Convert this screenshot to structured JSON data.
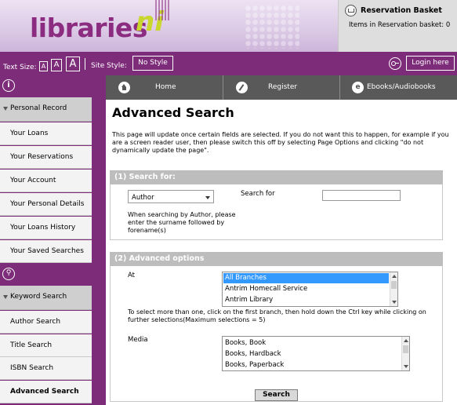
{
  "header": {
    "logo_text": "libraries",
    "logo_ni": "ni",
    "basket_title": "Reservation Basket",
    "basket_items": "Items in Reservation basket: 0"
  },
  "toolbar": {
    "text_size_label": "Text Size:",
    "text_size_options": [
      "A",
      "A",
      "A"
    ],
    "site_style_label": "Site Style:",
    "site_style_value": "No Style",
    "login_label": "Login here"
  },
  "sidebar": {
    "section1": {
      "icon": "info-icon",
      "header": "Personal Record",
      "items": [
        "Your Loans",
        "Your Reservations",
        "Your Account",
        "Your Personal Details",
        "Your Loans History",
        "Your Saved Searches"
      ]
    },
    "section2": {
      "icon": "search-icon",
      "header": "Keyword Search",
      "items": [
        "Author Search",
        "Title Search",
        "ISBN Search",
        "Advanced Search"
      ],
      "active": "Advanced Search"
    }
  },
  "nav": {
    "tabs": [
      {
        "label": "Home",
        "icon": "home-icon"
      },
      {
        "label": "Register",
        "icon": "pencil-icon"
      },
      {
        "label": "Ebooks/Audiobooks",
        "icon": "ebook-icon"
      }
    ]
  },
  "main": {
    "title": "Advanced Search",
    "intro": "This page will update once certain fields are selected. If you do not want this to happen, for example if you are a screen reader user, then please switch this off by selecting Page Options and clicking \"do not dynamically update the page\".",
    "search_for": {
      "heading": "(1) Search for:",
      "field_selected": "Author",
      "search_for_label": "Search for",
      "search_value": "",
      "help": "When searching by Author, please enter the surname followed by forename(s)"
    },
    "advanced": {
      "heading": "(2) Advanced options",
      "at_label": "At",
      "branches": [
        "All Branches",
        "Antrim Homecall Service",
        "Antrim Library"
      ],
      "branch_selected": "All Branches",
      "multi_help": "To select more than one, click on the first branch, then hold down the Ctrl key while clicking on further selections(Maximum selections = 5)",
      "media_label": "Media",
      "media": [
        "Books, Book",
        "Books, Hardback",
        "Books, Paperback"
      ]
    },
    "search_button": "Search"
  },
  "colors": {
    "brand_purple": "#7d2c79",
    "nav_grey": "#595959",
    "panel_header": "#bdbdbd",
    "selection": "#3399ff"
  }
}
